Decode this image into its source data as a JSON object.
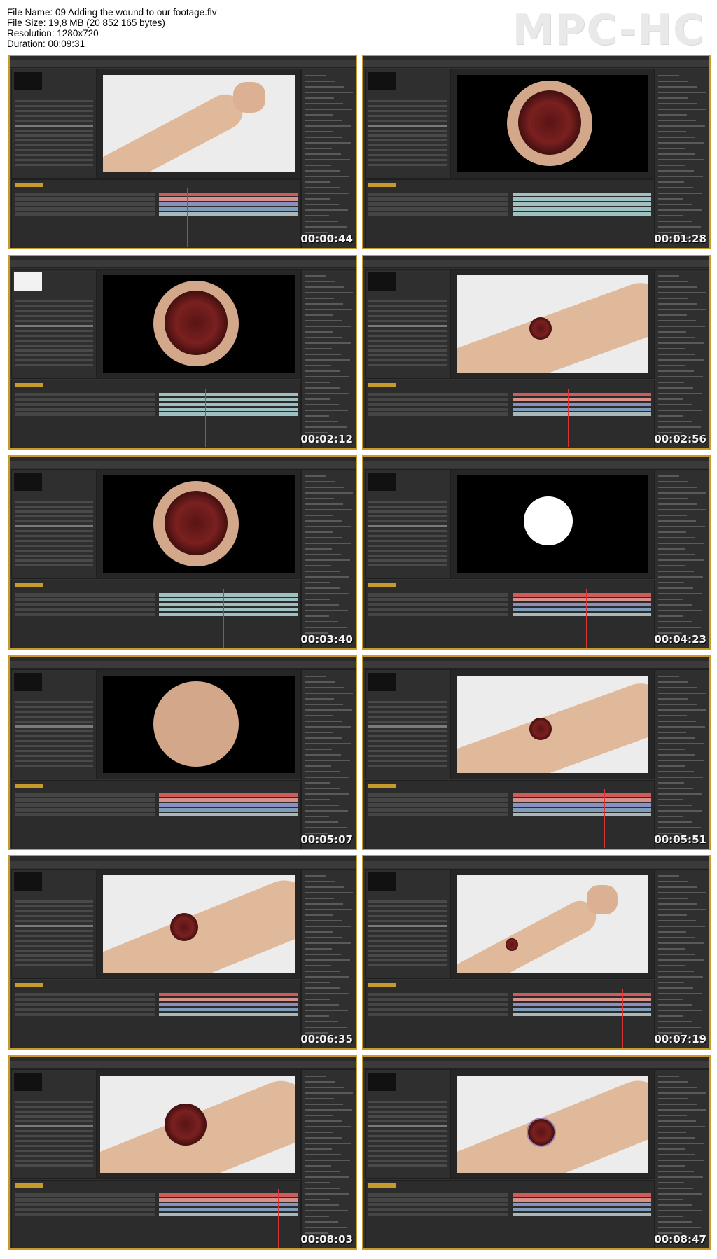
{
  "header": {
    "file_name": "File Name: 09 Adding the wound to our footage.flv",
    "file_size": "File Size: 19,8 MB (20 852 165 bytes)",
    "resolution": "Resolution: 1280x720",
    "duration": "Duration: 00:09:31",
    "logo": "MPC-HC"
  },
  "thumbnails": [
    {
      "timestamp": "00:00:44",
      "scene": "arm-fist"
    },
    {
      "timestamp": "00:01:28",
      "scene": "wound-disc"
    },
    {
      "timestamp": "00:02:12",
      "scene": "wound-disc"
    },
    {
      "timestamp": "00:02:56",
      "scene": "arm-wound"
    },
    {
      "timestamp": "00:03:40",
      "scene": "wound-disc"
    },
    {
      "timestamp": "00:04:23",
      "scene": "mask"
    },
    {
      "timestamp": "00:05:07",
      "scene": "blank-disc"
    },
    {
      "timestamp": "00:05:51",
      "scene": "arm-wound"
    },
    {
      "timestamp": "00:06:35",
      "scene": "arm-wound-large"
    },
    {
      "timestamp": "00:07:19",
      "scene": "arm-fist-small"
    },
    {
      "timestamp": "00:08:03",
      "scene": "arm-wound-curves"
    },
    {
      "timestamp": "00:08:47",
      "scene": "arm-wound-ring"
    }
  ]
}
